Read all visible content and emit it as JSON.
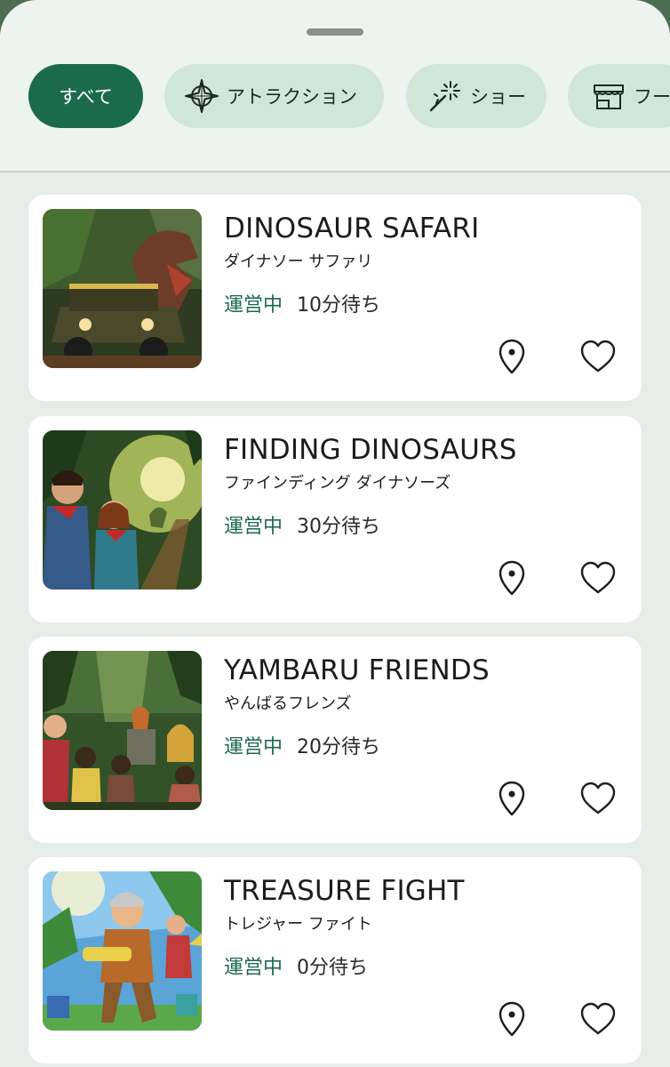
{
  "filters": [
    {
      "label": "すべて",
      "icon": "",
      "active": true
    },
    {
      "label": "アトラクション",
      "icon": "compass-icon",
      "active": false
    },
    {
      "label": "ショー",
      "icon": "sparkle-wand-icon",
      "active": false
    },
    {
      "label": "フー",
      "icon": "store-icon",
      "active": false
    }
  ],
  "attractions": [
    {
      "title": "DINOSAUR SAFARI",
      "subtitle": "ダイナソー サファリ",
      "status": "運営中",
      "wait": "10分待ち",
      "image": "jeep-and-dinosaur-photo"
    },
    {
      "title": "FINDING DINOSAURS",
      "subtitle": "ファインディング ダイナソーズ",
      "status": "運営中",
      "wait": "30分待ち",
      "image": "children-in-jungle-photo"
    },
    {
      "title": "YAMBARU FRIENDS",
      "subtitle": "やんばるフレンズ",
      "status": "運営中",
      "wait": "20分待ち",
      "image": "family-in-rainforest-photo"
    },
    {
      "title": "TREASURE FIGHT",
      "subtitle": "トレジャー ファイト",
      "status": "運営中",
      "wait": "0分待ち",
      "image": "kids-water-blaster-photo"
    }
  ],
  "colors": {
    "accent": "#1b6a4e",
    "chip": "#cfe6d9",
    "background": "#e6ede9"
  }
}
